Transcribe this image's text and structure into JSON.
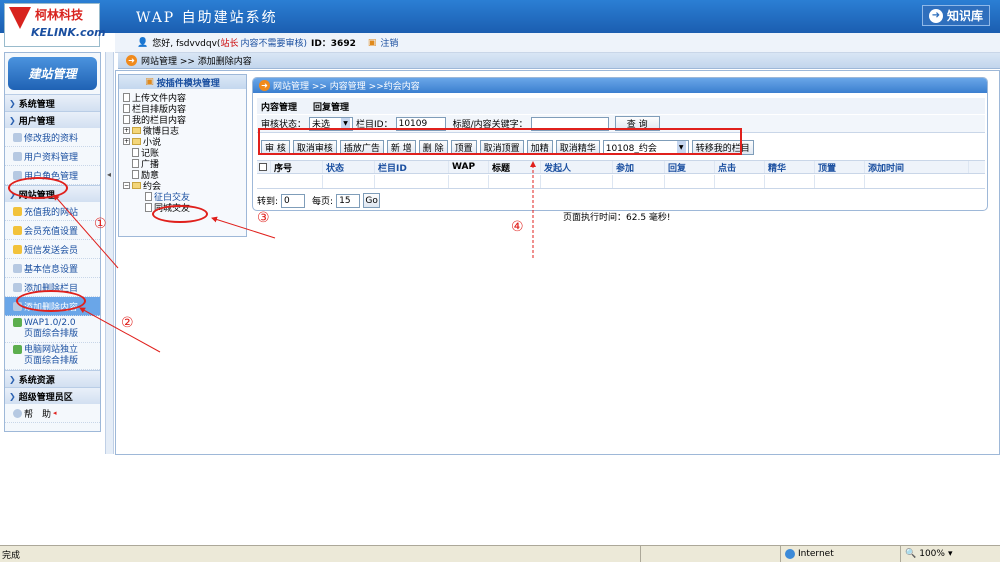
{
  "brand": {
    "logo_cn": "柯林科技",
    "logo_en": "KELINK.com",
    "app_title": "WAP 自助建站系统",
    "kb_button": "知识库"
  },
  "userbar": {
    "greeting": "您好, fsdvvdqv(",
    "role": "站长",
    "note": "内容不需要审核)",
    "id_text": "ID：3692",
    "logout": "注销"
  },
  "breadcrumb": {
    "text": "网站管理 >> 添加删除内容"
  },
  "sidebar": {
    "header": "建站管理",
    "sections": {
      "system": "系统管理",
      "user": "用户管理",
      "site": "网站管理",
      "resources": "系统资源",
      "super": "超级管理员区"
    },
    "user_items": [
      "修改我的资料",
      "用户资料管理",
      "用户角色管理"
    ],
    "site_items": [
      "充值我的网站",
      "会员充值设置",
      "短信发送会员",
      "基本信息设置",
      "添加删除栏目",
      "添加删除内容"
    ],
    "wap_item": [
      "WAP1.0/2.0",
      "页面综合排版"
    ],
    "pc_item": [
      "电脑网站独立",
      "页面综合排版"
    ],
    "help": "帮　助"
  },
  "tree": {
    "title": "按插件模块管理",
    "top_items": [
      "上传文件内容",
      "栏目排版内容",
      "我的栏目内容"
    ],
    "nodes": [
      "微博日志",
      "小说",
      "记账",
      "广播",
      "励意",
      "约会",
      "征白交友",
      "同城交友"
    ]
  },
  "panel": {
    "crumb": "网站管理 >> 内容管理 >>约会内容",
    "tabs": [
      "内容管理",
      "回复管理"
    ],
    "filter": {
      "status_label": "审核状态：",
      "status_value": "未选",
      "column_label": "栏目ID：",
      "column_value": "10109",
      "keyword_label": "标题/内容关键字：",
      "keyword_value": "",
      "query_button": "查 询"
    },
    "actions": [
      "审 核",
      "取消审核",
      "插放广告",
      "新 增",
      "删 除",
      "顶置",
      "取消顶置",
      "加精",
      "取消精华"
    ],
    "target_select": "10108_约会",
    "move_button": "转移我的栏目",
    "columns": [
      "序号",
      "状态",
      "栏目ID",
      "WAP",
      "标题",
      "发起人",
      "参加",
      "回复",
      "点击",
      "精华",
      "顶置",
      "添加时间"
    ],
    "pager": {
      "goto_label": "转到:",
      "goto_value": "0",
      "per_page_label": "每页:",
      "per_page_value": "15",
      "go": "Go"
    }
  },
  "exec_time": "页面执行时间：62.5 毫秒!",
  "annotations": [
    "①",
    "②",
    "③",
    "④"
  ],
  "statusbar": {
    "left": "完成",
    "zone": "Internet",
    "zoom": "100%"
  },
  "colors": {
    "accent": "#1f62b4",
    "annotation": "#e0201c"
  }
}
